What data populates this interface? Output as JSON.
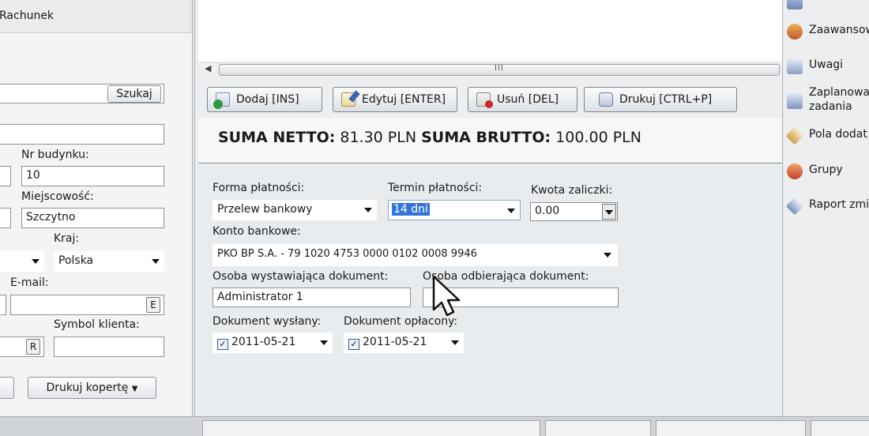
{
  "left_panel": {
    "top_item": "Rachunek",
    "search_button": "Szukaj",
    "nr_budynku_label": "Nr budynku:",
    "nr_budynku_value": "10",
    "miejscowosc_label": "Miejscowość:",
    "miejscowosc_value": "Szczytno",
    "kraj_label": "Kraj:",
    "kraj_value": "Polska",
    "email_label": "E-mail:",
    "email_button": "E",
    "symbol_label": "Symbol klienta:",
    "r_button": "R",
    "print_envelope_button": "Drukuj kopertę"
  },
  "toolbar": {
    "add": "Dodaj [INS]",
    "edit": "Edytuj [ENTER]",
    "delete": "Usuń [DEL]",
    "print": "Drukuj [CTRL+P]"
  },
  "totals": {
    "net_label": "SUMA NETTO:",
    "net_value": "81.30 PLN",
    "gross_label": "SUMA BRUTTO:",
    "gross_value": "100.00 PLN"
  },
  "payment_form": {
    "forma_label": "Forma płatności:",
    "forma_value": "Przelew bankowy",
    "termin_label": "Termin płatności:",
    "termin_value": "14 dni",
    "kwota_label": "Kwota zaliczki:",
    "kwota_value": "0.00",
    "konto_label": "Konto bankowe:",
    "konto_value": "PKO BP S.A. - 79 1020 4753 0000 0102 0008 9946",
    "wystawiajaca_label": "Osoba wystawiająca dokument:",
    "wystawiajaca_value": "Administrator 1",
    "odbierajaca_label": "Osoba odbierająca dokument:",
    "odbierajaca_value": "",
    "wyslany_label": "Dokument wysłany:",
    "wyslany_date": "2011-05-21",
    "oplacony_label": "Dokument opłacony:",
    "oplacony_date": "2011-05-21"
  },
  "right_panel": {
    "items": [
      "Zaawansow",
      "Uwagi",
      "Zaplanowa zadania",
      "Pola dodat",
      "Grupy",
      "Raport zmi"
    ]
  }
}
